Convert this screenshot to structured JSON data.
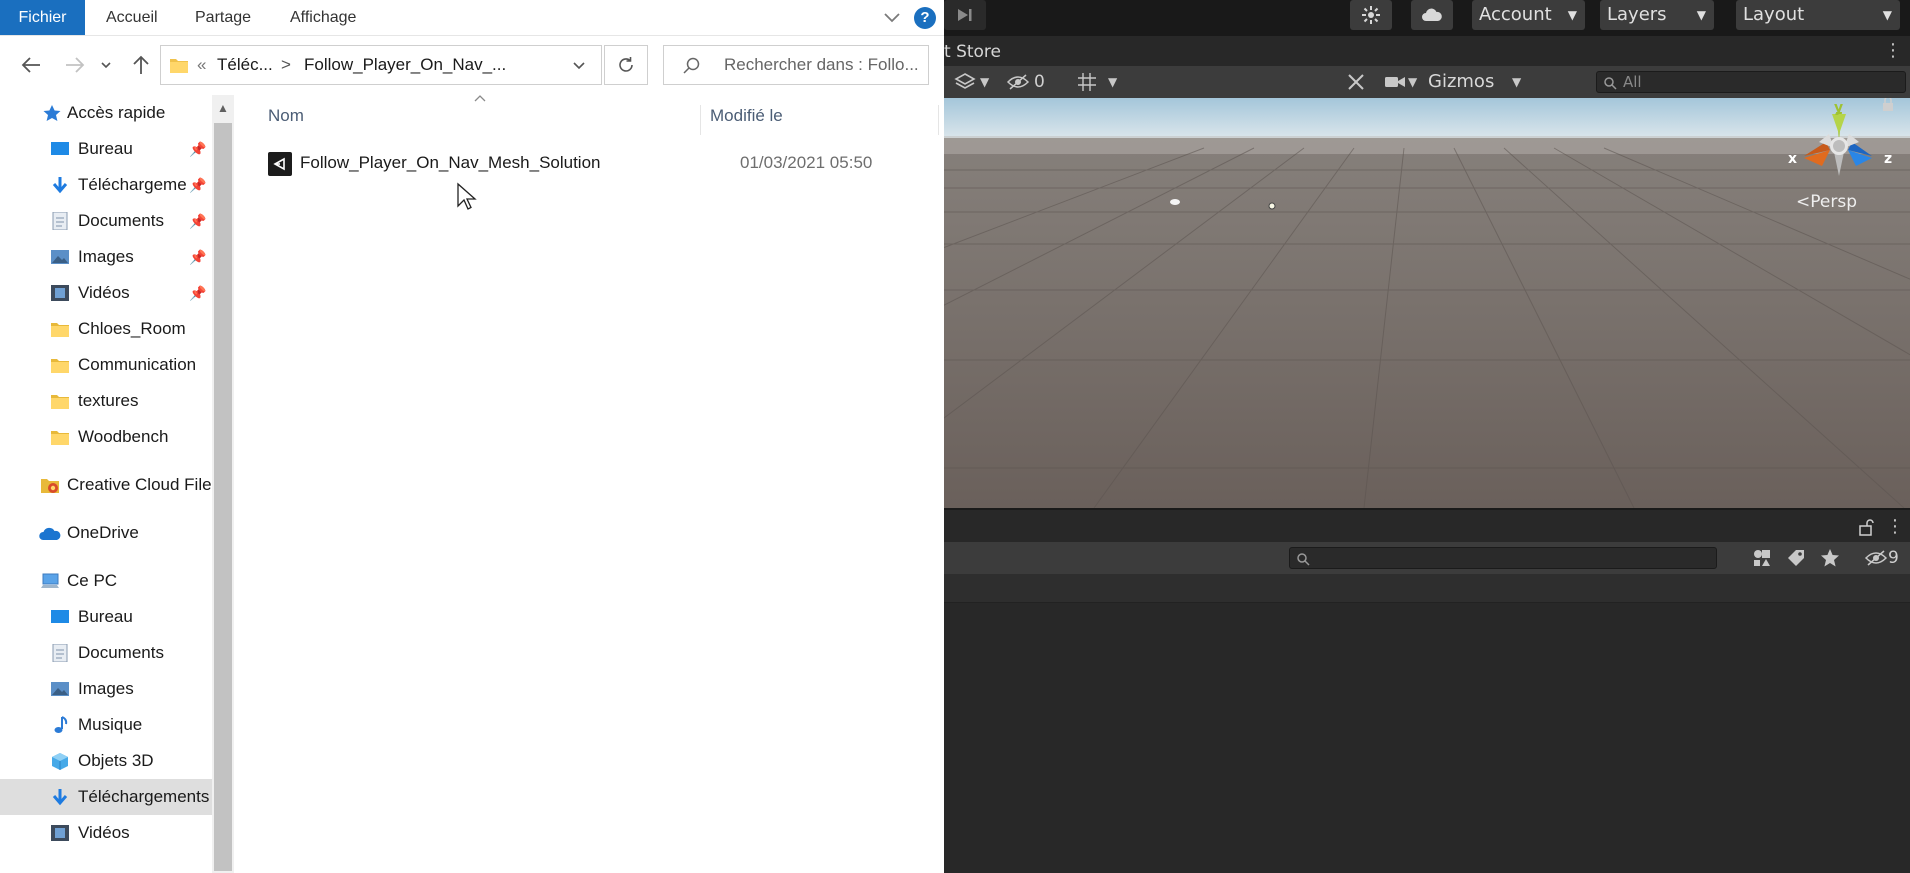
{
  "explorer": {
    "ribbon": {
      "tabs": [
        "Fichier",
        "Accueil",
        "Partage",
        "Affichage"
      ],
      "help": "?"
    },
    "address": {
      "chevrons": "«",
      "crumbs": [
        "Téléc...",
        "Follow_Player_On_Nav_..."
      ],
      "separator": ">"
    },
    "search": {
      "placeholder": "Rechercher dans : Follo..."
    },
    "sidebar": {
      "items": [
        {
          "label": "Accès rapide",
          "icon": "star-icon",
          "indent": 0,
          "pinned": false
        },
        {
          "label": "Bureau",
          "icon": "desktop-icon",
          "indent": 1,
          "pinned": true
        },
        {
          "label": "Téléchargeme",
          "icon": "download-icon",
          "indent": 1,
          "pinned": true
        },
        {
          "label": "Documents",
          "icon": "documents-icon",
          "indent": 1,
          "pinned": true
        },
        {
          "label": "Images",
          "icon": "images-icon",
          "indent": 1,
          "pinned": true
        },
        {
          "label": "Vidéos",
          "icon": "videos-icon",
          "indent": 1,
          "pinned": true
        },
        {
          "label": "Chloes_Room",
          "icon": "folder-icon",
          "indent": 1,
          "pinned": false
        },
        {
          "label": "Communication",
          "icon": "folder-icon",
          "indent": 1,
          "pinned": false
        },
        {
          "label": "textures",
          "icon": "folder-icon",
          "indent": 1,
          "pinned": false
        },
        {
          "label": "Woodbench",
          "icon": "folder-icon",
          "indent": 1,
          "pinned": false
        },
        {
          "label": "Creative Cloud File",
          "icon": "creative-cloud-icon",
          "indent": 0,
          "pinned": false
        },
        {
          "label": "OneDrive",
          "icon": "onedrive-icon",
          "indent": 0,
          "pinned": false
        },
        {
          "label": "Ce PC",
          "icon": "pc-icon",
          "indent": 0,
          "pinned": false
        },
        {
          "label": "Bureau",
          "icon": "desktop-icon",
          "indent": 1,
          "pinned": false
        },
        {
          "label": "Documents",
          "icon": "documents-icon",
          "indent": 1,
          "pinned": false
        },
        {
          "label": "Images",
          "icon": "images-icon",
          "indent": 1,
          "pinned": false
        },
        {
          "label": "Musique",
          "icon": "music-icon",
          "indent": 1,
          "pinned": false
        },
        {
          "label": "Objets 3D",
          "icon": "objects3d-icon",
          "indent": 1,
          "pinned": false
        },
        {
          "label": "Téléchargements",
          "icon": "download-icon",
          "indent": 1,
          "pinned": false,
          "selected": true
        },
        {
          "label": "Vidéos",
          "icon": "videos-icon",
          "indent": 1,
          "pinned": false
        }
      ]
    },
    "columns": {
      "name": "Nom",
      "modified": "Modifié le"
    },
    "files": [
      {
        "name": "Follow_Player_On_Nav_Mesh_Solution",
        "modified": "01/03/2021 05:50",
        "icon": "unity-file-icon"
      }
    ]
  },
  "unity": {
    "toolbar": {
      "account": "Account",
      "layers": "Layers",
      "layout": "Layout"
    },
    "scene_tab": {
      "title": "t Store"
    },
    "scene_toolbar": {
      "hidden_count": "0",
      "gizmos": "Gizmos",
      "search_placeholder": "All"
    },
    "gizmo": {
      "x": "x",
      "y": "y",
      "z": "z",
      "projection": "Persp"
    },
    "bottom_panel": {
      "hidden_count": "9"
    },
    "colors": {
      "panel": "#282828",
      "toolbar": "#3c3c3c",
      "top": "#191919"
    }
  }
}
